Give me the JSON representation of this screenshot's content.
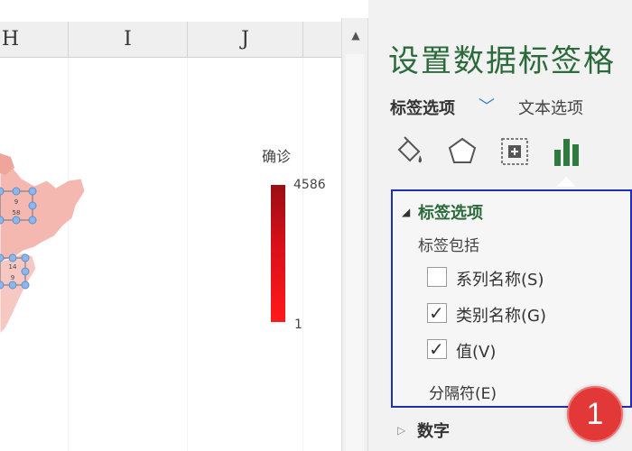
{
  "sheet": {
    "column_headers": [
      "H",
      "I",
      "J"
    ],
    "legend": {
      "title": "确诊",
      "max_label": "4586",
      "min_label": "1",
      "gradient_colors": [
        "#9b0d14",
        "#d9101a",
        "#ff1a1a"
      ]
    },
    "map": {
      "fill_color": "#f4b8b1",
      "handle_color": "#5b9bd5",
      "labels": [
        {
          "line1": "9",
          "line2": "58"
        },
        {
          "line1": "14",
          "line2": "9"
        }
      ]
    }
  },
  "pane": {
    "title": "设置数据标签格",
    "tabs": {
      "active": "标签选项",
      "inactive": "文本选项"
    },
    "icons": [
      "fill-line-icon",
      "effects-icon",
      "size-properties-icon",
      "label-options-icon"
    ],
    "label_options": {
      "section_title": "标签选项",
      "contains_label": "标签包括",
      "options": [
        {
          "label": "系列名称(S)",
          "checked": false
        },
        {
          "label": "类别名称(G)",
          "checked": true
        },
        {
          "label": "值(V)",
          "checked": true
        }
      ],
      "separator_label": "分隔符(E)"
    },
    "number_section": "数字",
    "accent_color": "#2b6a3b",
    "highlight_box_color": "#1f2fb8"
  },
  "annotation": {
    "badge_number": "1",
    "badge_color": "#e23838"
  }
}
